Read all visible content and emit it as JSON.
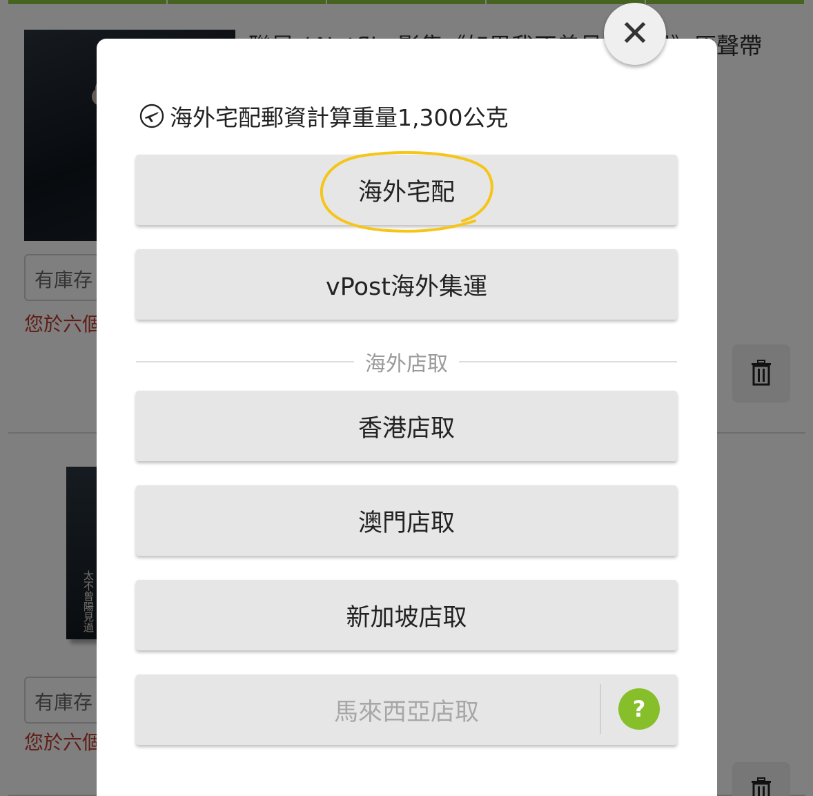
{
  "background": {
    "product_title": "聯昇 / Netflix 影集《如果我不曾見過太陽》原聲帶",
    "stock_label": "有庫存",
    "notice_text": "您於六個月內已購買過此商品",
    "cover_text": "太不曾陽見過"
  },
  "modal": {
    "close_symbol": "✕",
    "weight_text": "海外宅配郵資計算重量1,300公克",
    "options": [
      {
        "label": "海外宅配"
      },
      {
        "label": "vPost海外集運"
      },
      {
        "label": "香港店取"
      },
      {
        "label": "澳門店取"
      },
      {
        "label": "新加坡店取"
      },
      {
        "label": "馬來西亞店取"
      }
    ],
    "divider_label": "海外店取",
    "help_symbol": "?"
  },
  "colors": {
    "accent_green": "#8dc63f",
    "help_green": "#86bf2a",
    "notice_red": "#c0392b",
    "highlight_yellow": "#f5c518"
  },
  "icons": [
    "airplane-icon",
    "close-icon",
    "trash-icon",
    "help-icon"
  ]
}
